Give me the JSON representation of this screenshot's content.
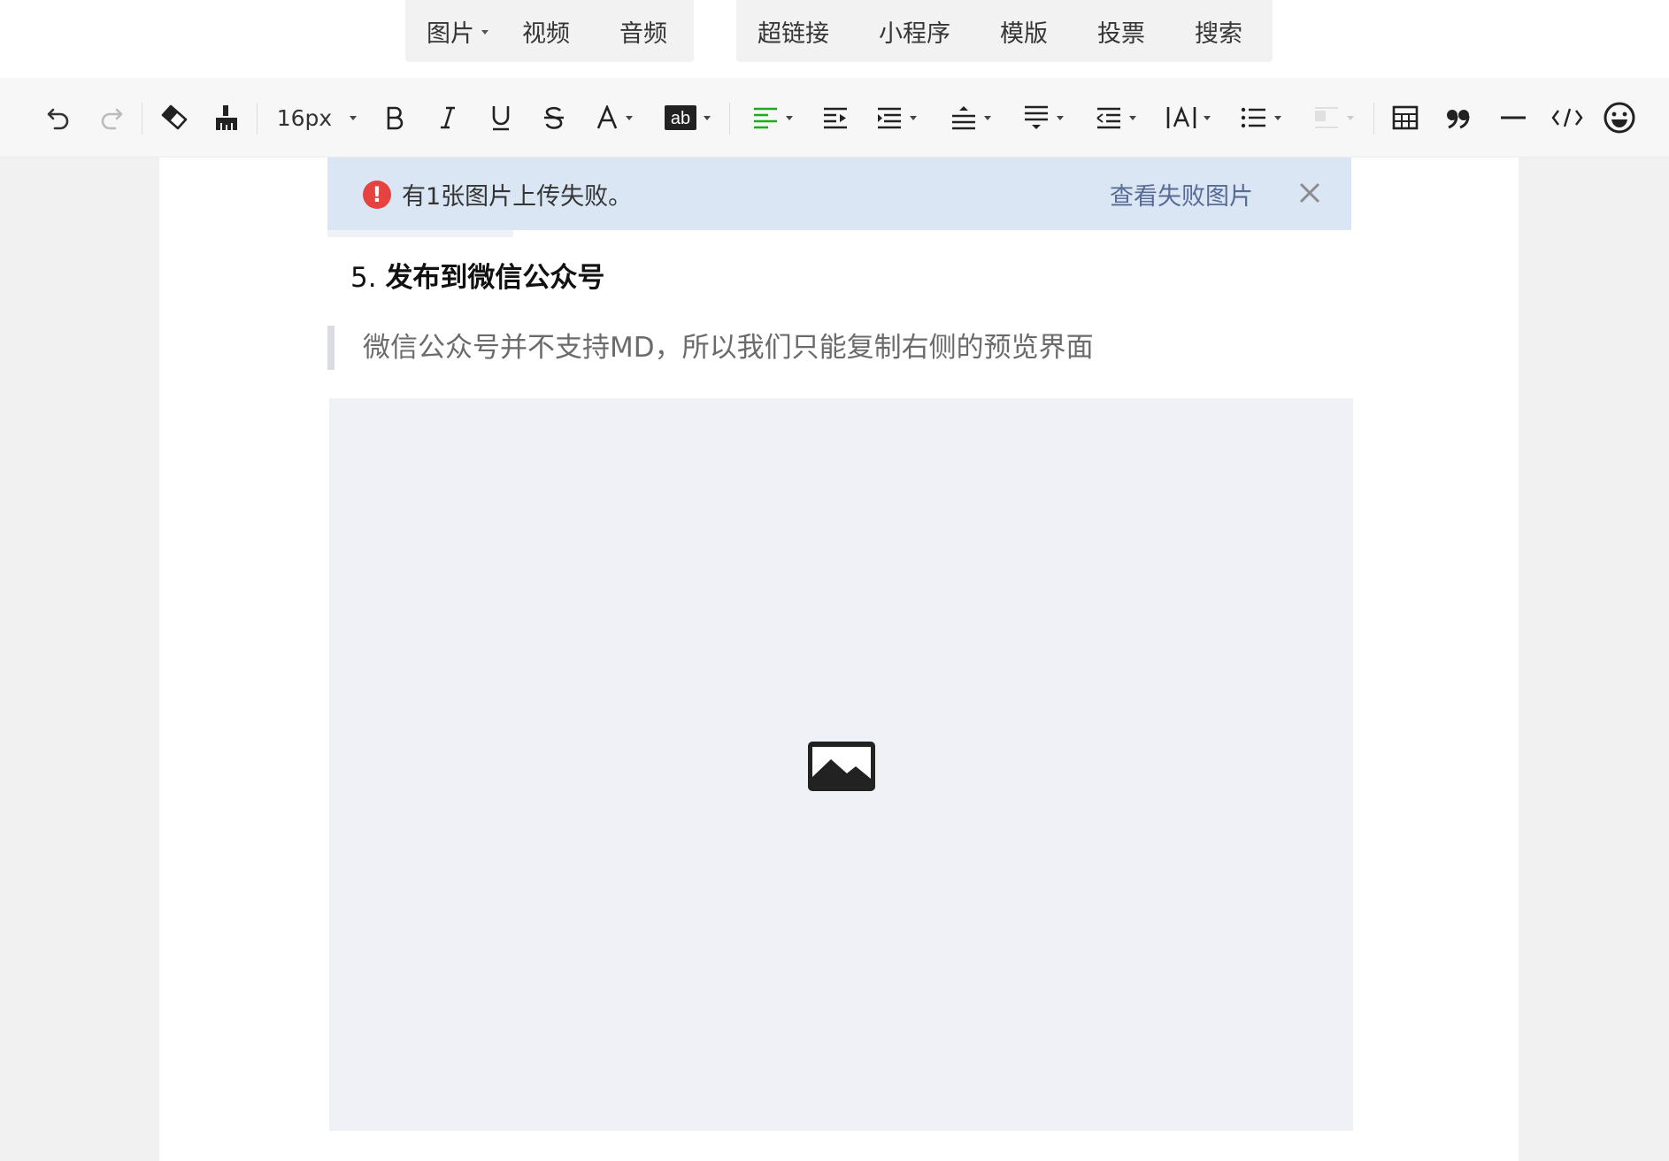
{
  "insert_bar": {
    "group1": [
      {
        "label": "图片",
        "has_dropdown": true
      },
      {
        "label": "视频"
      },
      {
        "label": "音频"
      }
    ],
    "group2": [
      {
        "label": "超链接"
      },
      {
        "label": "小程序"
      },
      {
        "label": "模版"
      },
      {
        "label": "投票"
      },
      {
        "label": "搜索"
      }
    ]
  },
  "toolbar": {
    "font_size": "16px",
    "icons": [
      "undo-icon",
      "redo-icon",
      "eraser-icon",
      "format-painter-icon",
      "bold-icon",
      "italic-icon",
      "underline-icon",
      "strikethrough-icon",
      "font-color-icon",
      "background-color-icon",
      "align-left-icon",
      "indent-icon",
      "paragraph-indent-icon",
      "line-spacing-before-icon",
      "line-spacing-after-icon",
      "line-height-icon",
      "letter-spacing-icon",
      "unordered-list-icon",
      "float-icon",
      "table-icon",
      "quote-icon",
      "divider-icon",
      "code-icon",
      "emoji-icon"
    ],
    "accent_color": "#1aad19"
  },
  "notice": {
    "text": "有1张图片上传失败。",
    "link": "查看失败图片",
    "background": "#dae6f4",
    "link_color": "#576b95",
    "icon_color": "#e64340"
  },
  "content": {
    "heading_number": "5.",
    "heading_text": "发布到微信公众号",
    "quote_text": "微信公众号并不支持MD，所以我们只能复制右侧的预览界面"
  }
}
